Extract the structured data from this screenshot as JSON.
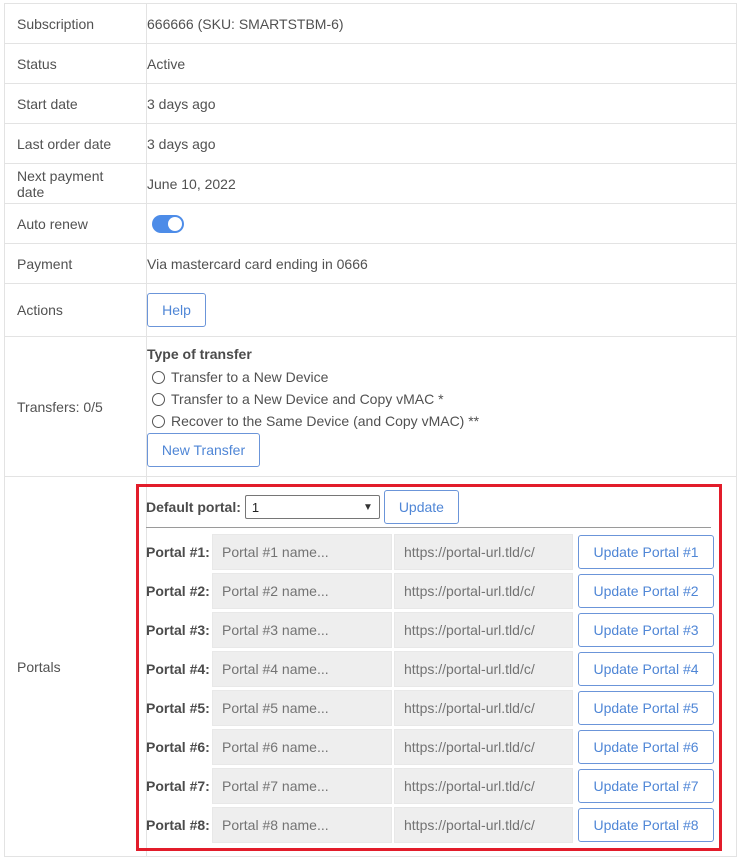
{
  "rows": {
    "subscription": {
      "label": "Subscription",
      "value": "666666 (SKU: SMARTSTBM-6)"
    },
    "status": {
      "label": "Status",
      "value": "Active"
    },
    "start_date": {
      "label": "Start date",
      "value": "3 days ago"
    },
    "last_order": {
      "label": "Last order date",
      "value": "3 days ago"
    },
    "next_payment": {
      "label": "Next payment date",
      "value": "June 10, 2022"
    },
    "auto_renew": {
      "label": "Auto renew",
      "enabled": true
    },
    "payment": {
      "label": "Payment",
      "value": "Via mastercard card ending in 0666"
    },
    "actions": {
      "label": "Actions",
      "help_button": "Help"
    },
    "transfers": {
      "label": "Transfers: 0/5",
      "title": "Type of transfer",
      "options": [
        "Transfer to a New Device",
        "Transfer to a New Device and Copy vMAC *",
        "Recover to the Same Device (and Copy vMAC) **"
      ],
      "new_transfer_button": "New Transfer"
    },
    "portals": {
      "label": "Portals",
      "default_label": "Default portal:",
      "default_value": "1",
      "update_button": "Update",
      "items": [
        {
          "label": "Portal #1:",
          "name_placeholder": "Portal #1 name...",
          "url_placeholder": "https://portal-url.tld/c/",
          "button": "Update Portal #1"
        },
        {
          "label": "Portal #2:",
          "name_placeholder": "Portal #2 name...",
          "url_placeholder": "https://portal-url.tld/c/",
          "button": "Update Portal #2"
        },
        {
          "label": "Portal #3:",
          "name_placeholder": "Portal #3 name...",
          "url_placeholder": "https://portal-url.tld/c/",
          "button": "Update Portal #3"
        },
        {
          "label": "Portal #4:",
          "name_placeholder": "Portal #4 name...",
          "url_placeholder": "https://portal-url.tld/c/",
          "button": "Update Portal #4"
        },
        {
          "label": "Portal #5:",
          "name_placeholder": "Portal #5 name...",
          "url_placeholder": "https://portal-url.tld/c/",
          "button": "Update Portal #5"
        },
        {
          "label": "Portal #6:",
          "name_placeholder": "Portal #6 name...",
          "url_placeholder": "https://portal-url.tld/c/",
          "button": "Update Portal #6"
        },
        {
          "label": "Portal #7:",
          "name_placeholder": "Portal #7 name...",
          "url_placeholder": "https://portal-url.tld/c/",
          "button": "Update Portal #7"
        },
        {
          "label": "Portal #8:",
          "name_placeholder": "Portal #8 name...",
          "url_placeholder": "https://portal-url.tld/c/",
          "button": "Update Portal #8"
        }
      ]
    }
  },
  "colors": {
    "accent": "#4f86d6",
    "toggle_on": "#4d8ce8",
    "highlight_border": "#e21c2a"
  },
  "icons": {
    "select_arrow": "chevron-down-icon",
    "radio": "radio-button-icon"
  }
}
